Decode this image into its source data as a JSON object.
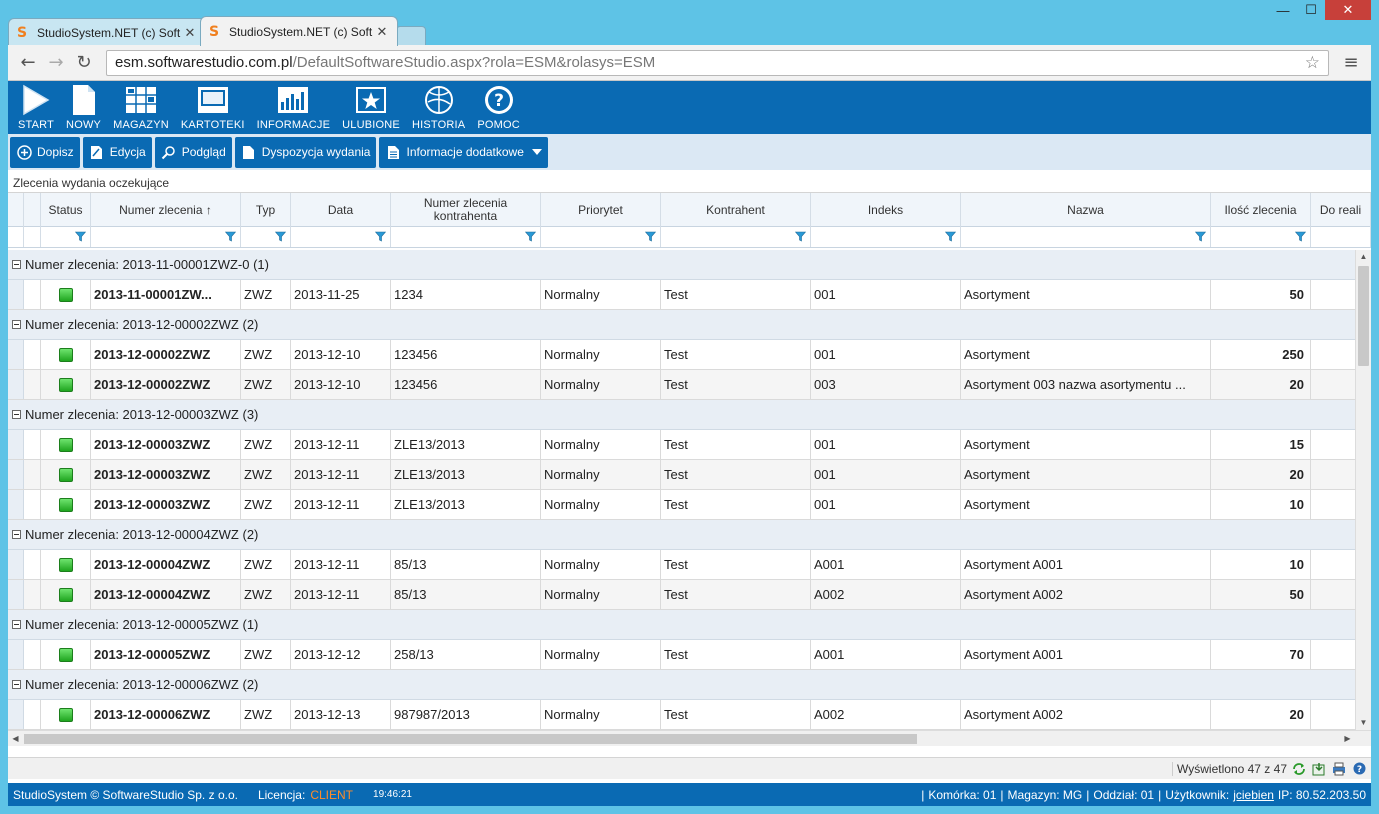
{
  "browser": {
    "tabs": [
      {
        "title": "StudioSystem.NET (c) Soft",
        "active": false
      },
      {
        "title": "StudioSystem.NET (c) Soft",
        "active": true
      }
    ],
    "url_host": "esm.softwarestudio.com.pl",
    "url_path": "/DefaultSoftwareStudio.aspx?rola=ESM&rolasys=ESM"
  },
  "main_menu": [
    {
      "label": "START",
      "icon": "play-icon"
    },
    {
      "label": "NOWY",
      "icon": "new-document-icon"
    },
    {
      "label": "MAGAZYN",
      "icon": "warehouse-grid-icon"
    },
    {
      "label": "KARTOTEKI",
      "icon": "card-file-icon"
    },
    {
      "label": "INFORMACJE",
      "icon": "bar-chart-icon"
    },
    {
      "label": "ULUBIONE",
      "icon": "favorite-star-icon"
    },
    {
      "label": "HISTORIA",
      "icon": "history-icon"
    },
    {
      "label": "POMOC",
      "icon": "help-icon"
    }
  ],
  "toolbar": [
    {
      "label": "Dopisz",
      "icon": "plus-circle-icon"
    },
    {
      "label": "Edycja",
      "icon": "edit-icon"
    },
    {
      "label": "Podgląd",
      "icon": "magnifier-icon"
    },
    {
      "label": "Dyspozycja wydania",
      "icon": "document-icon"
    },
    {
      "label": "Informacje dodatkowe",
      "icon": "document-icon",
      "dropdown": true
    }
  ],
  "grid_title": "Zlecenia wydania oczekujące",
  "columns": [
    "Status",
    "Numer zlecenia ↑",
    "Typ",
    "Data",
    "Numer zlecenia kontrahenta",
    "Priorytet",
    "Kontrahent",
    "Indeks",
    "Nazwa",
    "Ilość zlecenia",
    "Do reali"
  ],
  "groups": [
    {
      "label": "Numer zlecenia: 2013-11-00001ZWZ-0 (1)",
      "rows": [
        {
          "numer": "2013-11-00001ZW...",
          "typ": "ZWZ",
          "data": "2013-11-25",
          "kontr_nr": "1234",
          "priorytet": "Normalny",
          "kontrahent": "Test",
          "indeks": "001",
          "nazwa": "Asortyment",
          "ilosc": "50"
        }
      ]
    },
    {
      "label": "Numer zlecenia: 2013-12-00002ZWZ (2)",
      "rows": [
        {
          "numer": "2013-12-00002ZWZ",
          "typ": "ZWZ",
          "data": "2013-12-10",
          "kontr_nr": "123456",
          "priorytet": "Normalny",
          "kontrahent": "Test",
          "indeks": "001",
          "nazwa": "Asortyment",
          "ilosc": "250"
        },
        {
          "numer": "2013-12-00002ZWZ",
          "typ": "ZWZ",
          "data": "2013-12-10",
          "kontr_nr": "123456",
          "priorytet": "Normalny",
          "kontrahent": "Test",
          "indeks": "003",
          "nazwa": "Asortyment 003 nazwa asortymentu ...",
          "ilosc": "20"
        }
      ]
    },
    {
      "label": "Numer zlecenia: 2013-12-00003ZWZ (3)",
      "rows": [
        {
          "numer": "2013-12-00003ZWZ",
          "typ": "ZWZ",
          "data": "2013-12-11",
          "kontr_nr": "ZLE13/2013",
          "priorytet": "Normalny",
          "kontrahent": "Test",
          "indeks": "001",
          "nazwa": "Asortyment",
          "ilosc": "15"
        },
        {
          "numer": "2013-12-00003ZWZ",
          "typ": "ZWZ",
          "data": "2013-12-11",
          "kontr_nr": "ZLE13/2013",
          "priorytet": "Normalny",
          "kontrahent": "Test",
          "indeks": "001",
          "nazwa": "Asortyment",
          "ilosc": "20"
        },
        {
          "numer": "2013-12-00003ZWZ",
          "typ": "ZWZ",
          "data": "2013-12-11",
          "kontr_nr": "ZLE13/2013",
          "priorytet": "Normalny",
          "kontrahent": "Test",
          "indeks": "001",
          "nazwa": "Asortyment",
          "ilosc": "10"
        }
      ]
    },
    {
      "label": "Numer zlecenia: 2013-12-00004ZWZ (2)",
      "rows": [
        {
          "numer": "2013-12-00004ZWZ",
          "typ": "ZWZ",
          "data": "2013-12-11",
          "kontr_nr": "85/13",
          "priorytet": "Normalny",
          "kontrahent": "Test",
          "indeks": "A001",
          "nazwa": "Asortyment A001",
          "ilosc": "10"
        },
        {
          "numer": "2013-12-00004ZWZ",
          "typ": "ZWZ",
          "data": "2013-12-11",
          "kontr_nr": "85/13",
          "priorytet": "Normalny",
          "kontrahent": "Test",
          "indeks": "A002",
          "nazwa": "Asortyment A002",
          "ilosc": "50"
        }
      ]
    },
    {
      "label": "Numer zlecenia: 2013-12-00005ZWZ (1)",
      "rows": [
        {
          "numer": "2013-12-00005ZWZ",
          "typ": "ZWZ",
          "data": "2013-12-12",
          "kontr_nr": "258/13",
          "priorytet": "Normalny",
          "kontrahent": "Test",
          "indeks": "A001",
          "nazwa": "Asortyment A001",
          "ilosc": "70"
        }
      ]
    },
    {
      "label": "Numer zlecenia: 2013-12-00006ZWZ (2)",
      "rows": [
        {
          "numer": "2013-12-00006ZWZ",
          "typ": "ZWZ",
          "data": "2013-12-13",
          "kontr_nr": "987987/2013",
          "priorytet": "Normalny",
          "kontrahent": "Test",
          "indeks": "A002",
          "nazwa": "Asortyment A002",
          "ilosc": "20"
        }
      ]
    }
  ],
  "pager": {
    "text": "Wyświetlono 47 z 47"
  },
  "footer": {
    "copyright": "StudioSystem © SoftwareStudio Sp. z o.o.",
    "license_label": "Licencja:",
    "license_value": "CLIENT",
    "clock": "19:46:21",
    "komorka": "Komórka: 01",
    "magazyn": "Magazyn: MG",
    "oddzial": "Oddział: 01",
    "uzytkownik_label": "Użytkownik:",
    "uzytkownik": "jciebien",
    "ip": "IP: 80.52.203.50"
  },
  "colors": {
    "accent": "#0a6ab3",
    "toolbar_bg": "#dbe8f4",
    "status_ok": "#2fbf2f",
    "license": "#ff8c2a"
  }
}
